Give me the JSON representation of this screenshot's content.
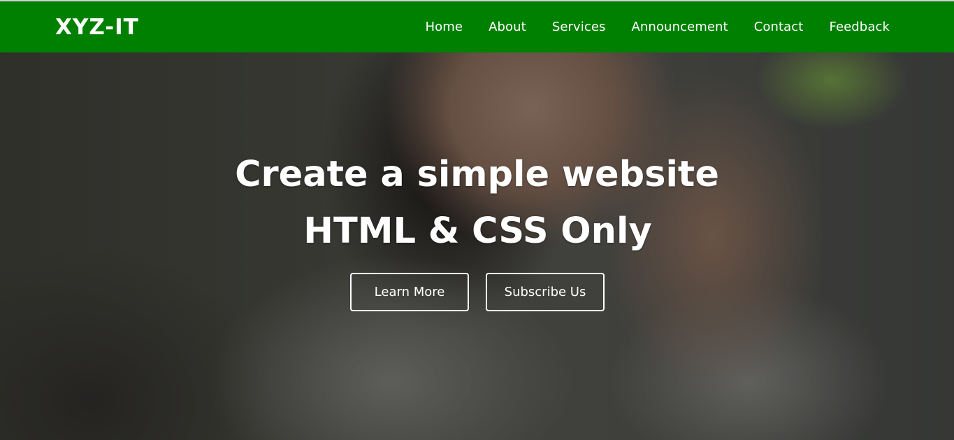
{
  "brand": {
    "name": "XYZ-IT"
  },
  "nav": {
    "items": [
      {
        "label": "Home"
      },
      {
        "label": "About"
      },
      {
        "label": "Services"
      },
      {
        "label": "Announcement"
      },
      {
        "label": "Contact"
      },
      {
        "label": "Feedback"
      }
    ]
  },
  "hero": {
    "title_line1": "Create a simple website",
    "title_line2": "HTML & CSS Only",
    "learn_more_label": "Learn More",
    "subscribe_label": "Subscribe Us"
  },
  "colors": {
    "navbar_bg": "#008000",
    "text": "#ffffff"
  }
}
